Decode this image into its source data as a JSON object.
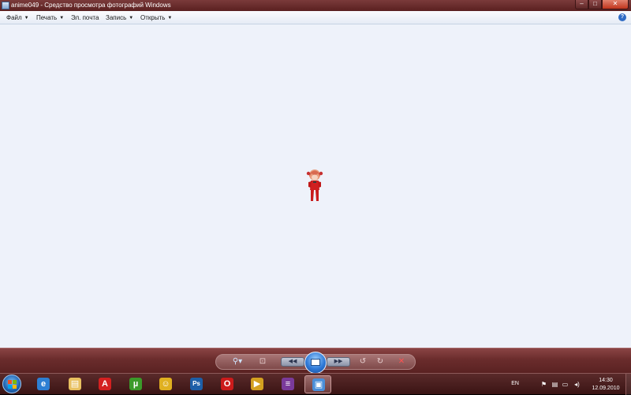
{
  "window": {
    "title": "anime049 - Средство просмотра фотографий Windows",
    "controls": {
      "minimize": "–",
      "maximize": "□",
      "close": "✕"
    }
  },
  "menu": {
    "items": [
      {
        "label": "Файл"
      },
      {
        "label": "Печать"
      },
      {
        "label": "Эл. почта"
      },
      {
        "label": "Запись"
      },
      {
        "label": "Открыть"
      }
    ],
    "arrow": "▼",
    "help": "?"
  },
  "controlbar": {
    "zoom": "⚲▾",
    "fit": "⊡",
    "prev": "◀◀",
    "next": "▶▶",
    "rotate_left": "↺",
    "rotate_right": "↻",
    "delete": "✕"
  },
  "taskbar": {
    "apps": [
      {
        "name": "internet-explorer",
        "glyph": "e",
        "color": "#2d7fd3"
      },
      {
        "name": "explorer",
        "glyph": "▤",
        "color": "#e8c060"
      },
      {
        "name": "avira",
        "glyph": "A",
        "color": "#d42020"
      },
      {
        "name": "utorrent",
        "glyph": "µ",
        "color": "#3b9a2a"
      },
      {
        "name": "messenger",
        "glyph": "☺",
        "color": "#e0b020"
      },
      {
        "name": "photoshop",
        "glyph": "Ps",
        "color": "#1d5fa8"
      },
      {
        "name": "opera",
        "glyph": "O",
        "color": "#cc1b1b"
      },
      {
        "name": "media-player",
        "glyph": "▶",
        "color": "#d4a020"
      },
      {
        "name": "winrar",
        "glyph": "≡",
        "color": "#7a3a9a"
      },
      {
        "name": "photo-viewer",
        "glyph": "▣",
        "color": "#4a8ed8"
      }
    ],
    "language": "EN",
    "tray_icons": [
      "⚑",
      "▤",
      "▭",
      "◂)"
    ],
    "time": "14:30",
    "date": "12.09.2010"
  }
}
